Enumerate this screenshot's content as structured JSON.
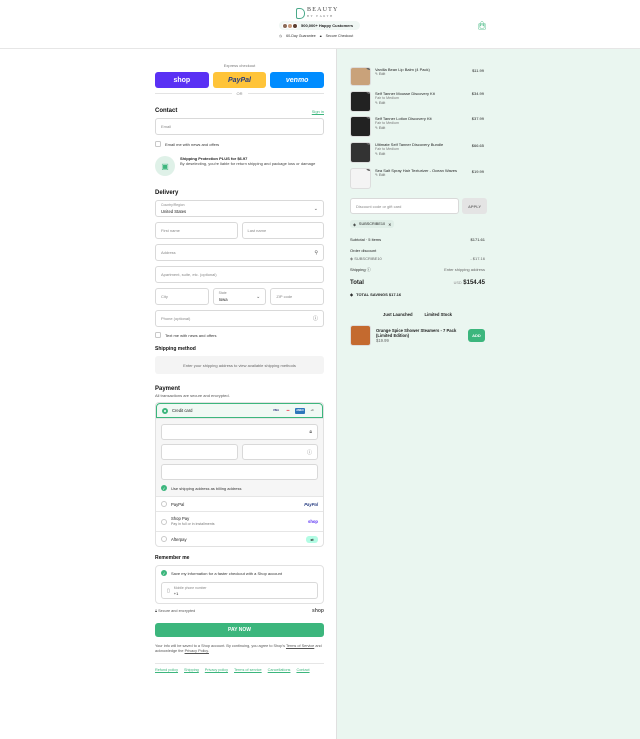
{
  "brand": {
    "name": "BEAUTY",
    "sub": "BY EARTH",
    "happy": "500,000+ Happy Customers",
    "guarantee": "60-Day Guarantee",
    "secure": "Secure Checkout"
  },
  "express": {
    "title": "Express checkout",
    "shop": "shop",
    "paypal": "PayPal",
    "venmo": "venmo",
    "or": "OR"
  },
  "contact": {
    "title": "Contact",
    "signin": "Sign in",
    "email_placeholder": "Email",
    "news": "Email me with news and offers"
  },
  "protection": {
    "title": "Shipping Protection PLUS for $6.97",
    "desc": "By deselecting, you're liable for return shipping and package loss or damage"
  },
  "delivery": {
    "title": "Delivery",
    "country_label": "Country/Region",
    "country": "United States",
    "first": "First name",
    "last": "Last name",
    "address": "Address",
    "apt": "Apartment, suite, etc. (optional)",
    "city": "City",
    "state_label": "State",
    "state": "Iowa",
    "zip": "ZIP code",
    "phone": "Phone (optional)",
    "text_me": "Text me with news and offers"
  },
  "shipping": {
    "title": "Shipping method",
    "note": "Enter your shipping address to view available shipping methods"
  },
  "payment": {
    "title": "Payment",
    "subtitle": "All transactions are secure and encrypted.",
    "credit": "Credit card",
    "more": "+4",
    "billing": "Use shipping address as billing address",
    "paypal": "PayPal",
    "shoppay": "Shop Pay",
    "shoppay_sub": "Pay in full or in installments",
    "shop_logo": "shop",
    "afterpay": "Afterpay",
    "cards": [
      "VISA",
      "MC",
      "AMEX"
    ]
  },
  "remember": {
    "title": "Remember me",
    "save": "Save my information for a faster checkout with a Shop account",
    "phone_label": "Mobile phone number",
    "phone_val": "+1",
    "secure": "Secure and encrypted",
    "shop": "shop"
  },
  "paynow": "PAY NOW",
  "legal": {
    "text": "Your info will be saved to a Shop account. By continuing, you agree to Shop's",
    "tos": "Terms of Service",
    "and": "and acknowledge the",
    "privacy": "Privacy Policy."
  },
  "footer": [
    "Refund policy",
    "Shipping",
    "Privacy policy",
    "Terms of service",
    "Cancellations",
    "Contact"
  ],
  "items": [
    {
      "name": "Vanilla Bean Lip Balm (4 Pack)",
      "variant": "",
      "edit": "Edit",
      "price": "$11.99",
      "qty": "1"
    },
    {
      "name": "Self Tanner Mousse Discovery Kit",
      "variant": "Fair to Medium",
      "edit": "Edit",
      "price": "$34.99",
      "qty": "1"
    },
    {
      "name": "Self Tanner Lotion Discovery Kit",
      "variant": "Fair to Medium",
      "edit": "Edit",
      "price": "$37.99",
      "qty": "1"
    },
    {
      "name": "Ultimate Self Tanner Discovery Bundle",
      "variant": "Fair to Medium",
      "edit": "Edit",
      "price": "$66.65",
      "qty": "1"
    },
    {
      "name": "Sea Salt Spray Hair Texturizer - Ocean Waves",
      "variant": "",
      "edit": "Edit",
      "price": "$19.99",
      "qty": "1"
    }
  ],
  "discount": {
    "placeholder": "Discount code or gift card",
    "apply": "APPLY",
    "code": "SUBSCRIBE10"
  },
  "summary": {
    "subtotal_label": "Subtotal · 5 items",
    "subtotal": "$171.61",
    "order_disc": "Order discount",
    "code": "SUBSCRIBE10",
    "disc_val": "- $17.16",
    "ship_label": "Shipping",
    "ship_val": "Enter shipping address",
    "total_label": "Total",
    "currency": "USD",
    "total": "$154.45",
    "savings": "TOTAL SAVINGS $17.16"
  },
  "upsell": {
    "tab1": "Just Launched",
    "tab2": "Limited Stock",
    "name": "Orange Spice Shower Steamers - 7 Pack (Limited Edition)",
    "price": "$19.99",
    "add": "ADD"
  }
}
